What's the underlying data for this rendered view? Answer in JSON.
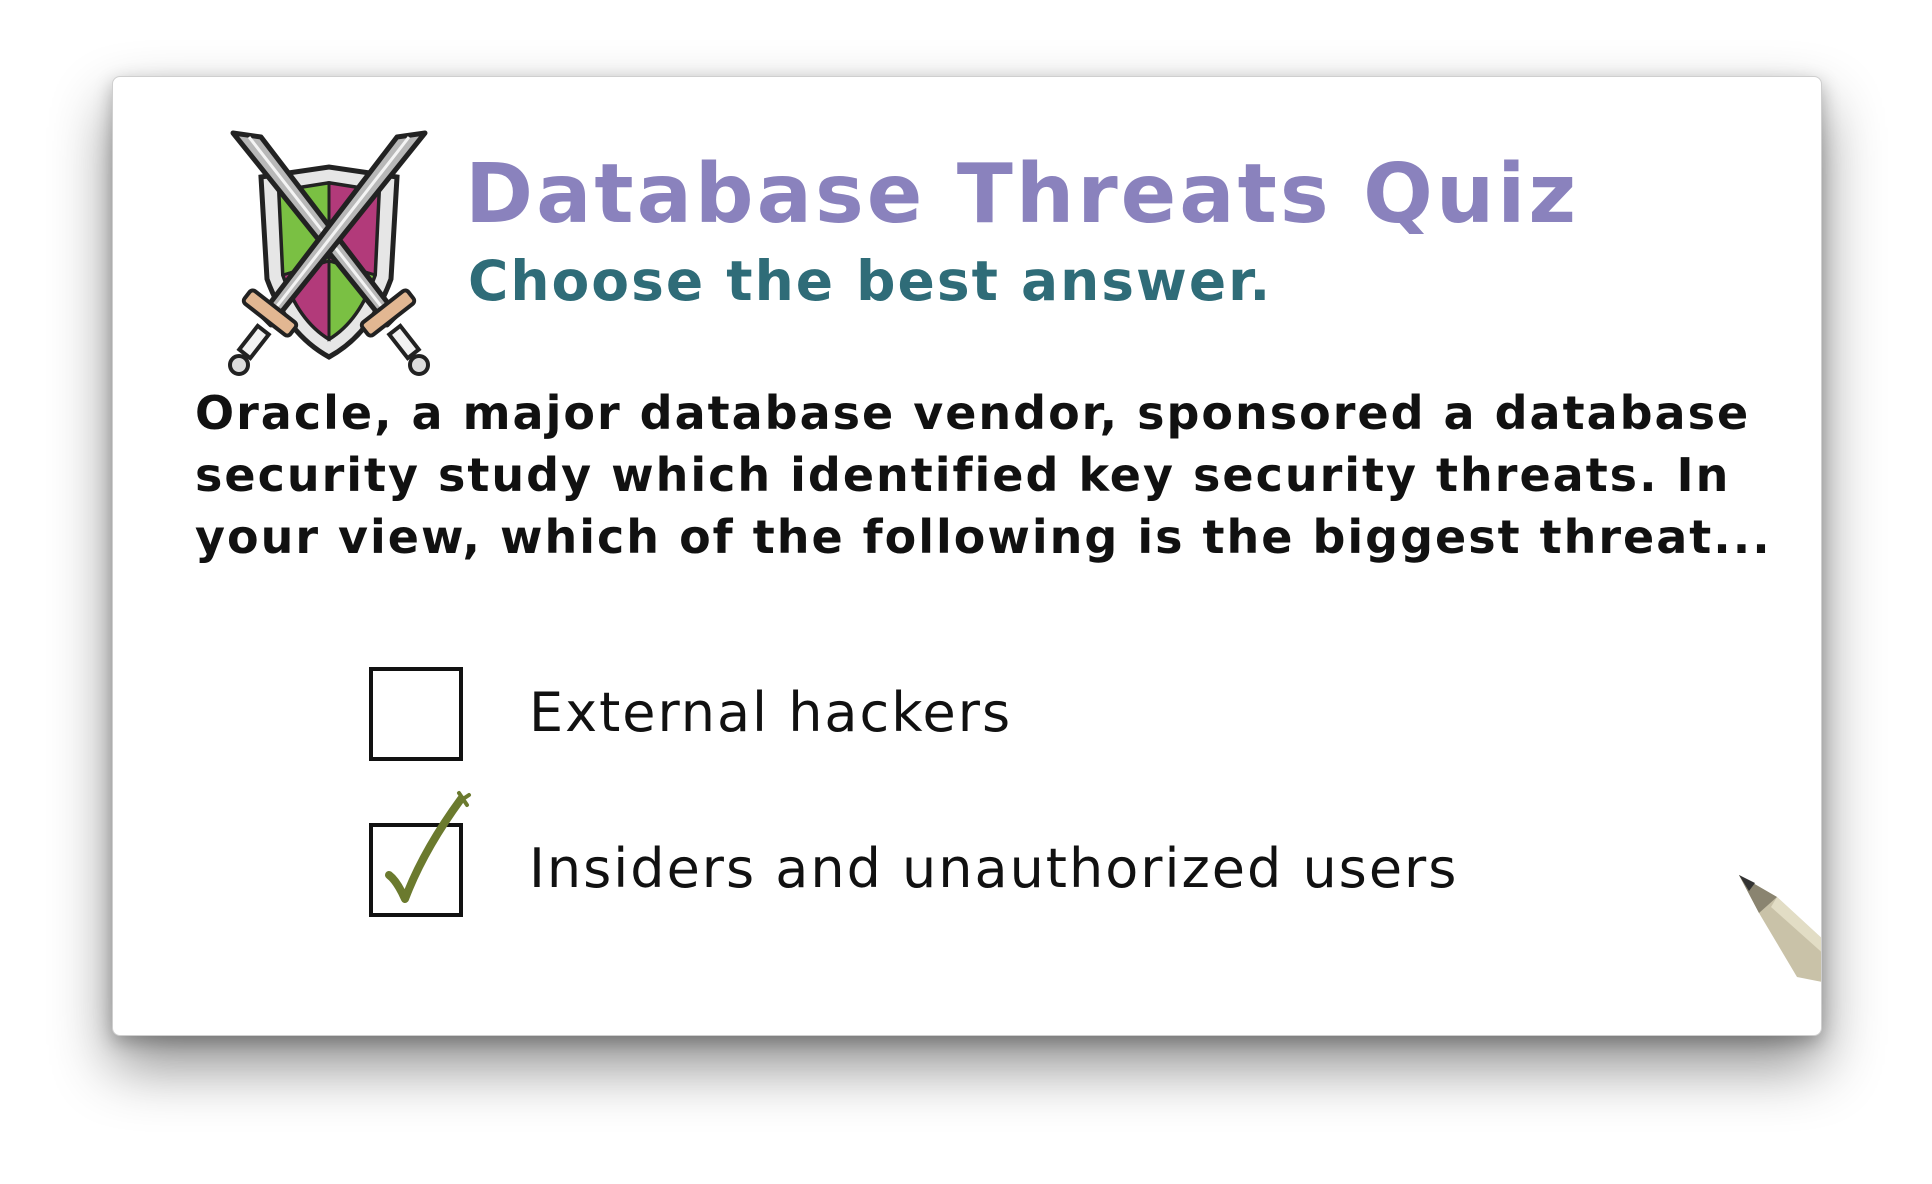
{
  "quiz": {
    "title": "Database Threats Quiz",
    "subtitle": "Choose the best answer.",
    "question_lines": [
      "Oracle, a major database vendor, sponsored a database",
      "security study which identified key security threats. In",
      "your view, which of the following is the biggest threat..."
    ],
    "options": [
      {
        "label": "External hackers",
        "checked": false
      },
      {
        "label": "Insiders and unauthorized users",
        "checked": true
      }
    ]
  },
  "icons": {
    "emblem": "crossed-swords-shield-icon",
    "checkmark": "checkmark-icon",
    "pen": "pen-tip-icon"
  },
  "colors": {
    "title": "#8a82bd",
    "subtitle": "#2f6c78",
    "text": "#111111",
    "checkmark": "#6b7a2e",
    "shield_green": "#7ac043",
    "shield_magenta": "#b23a7a"
  }
}
